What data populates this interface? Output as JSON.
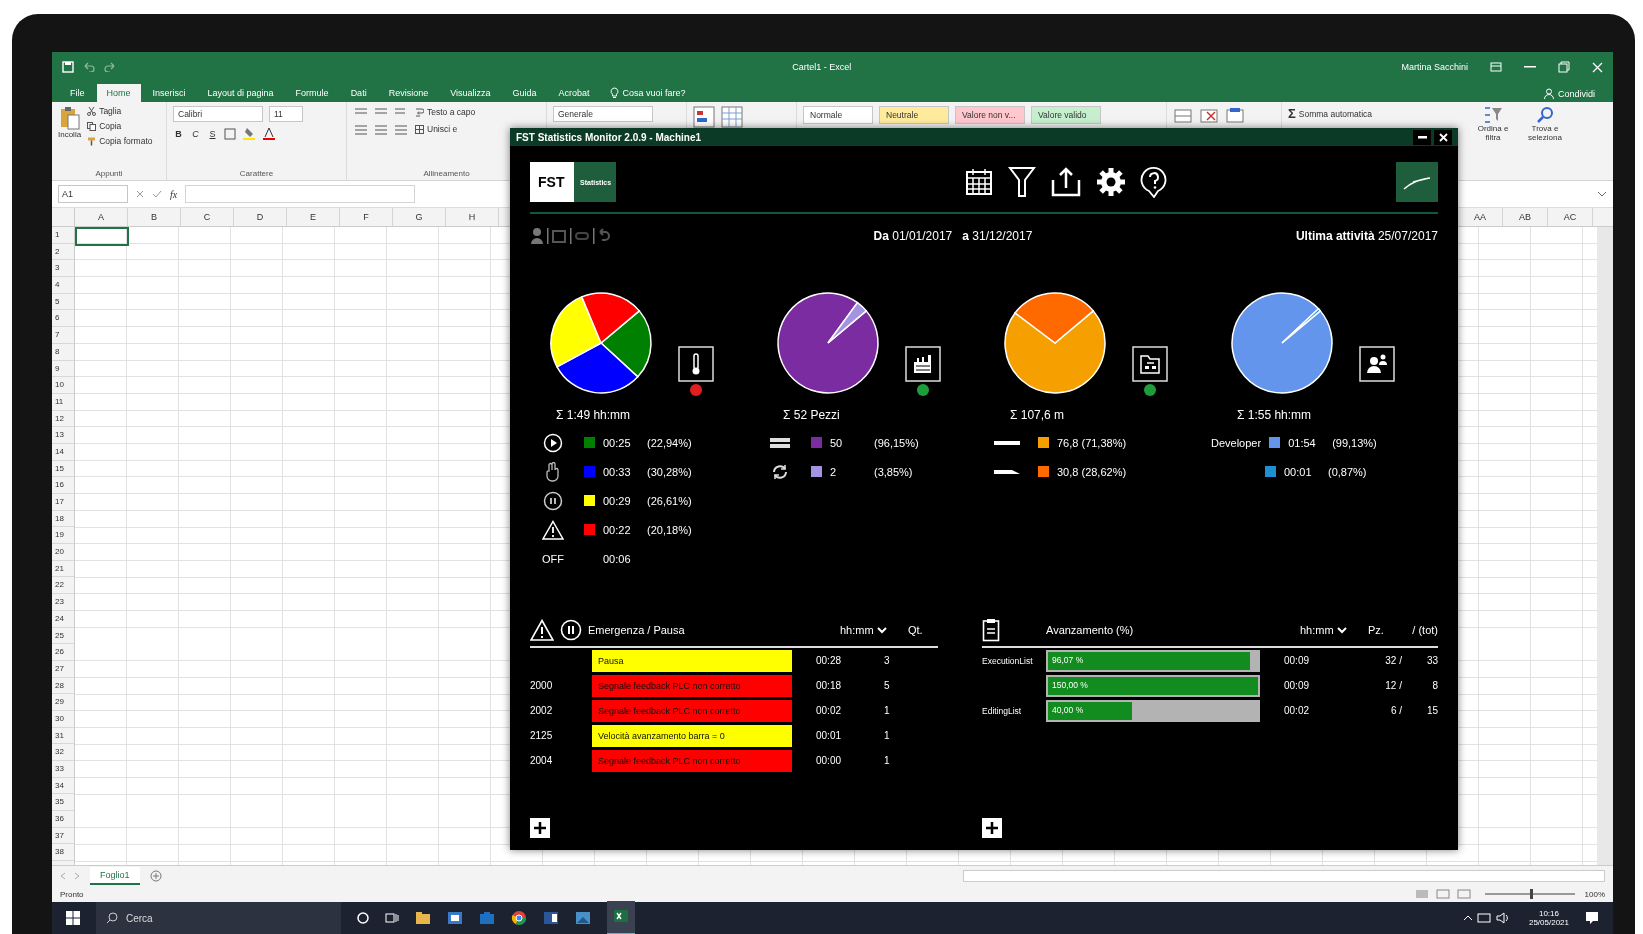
{
  "excel": {
    "title": "Cartel1 - Excel",
    "user": "Martina Sacchini",
    "share": "Condividi",
    "tabs": [
      {
        "label": "File",
        "selected": false
      },
      {
        "label": "Home",
        "selected": true
      },
      {
        "label": "Inserisci",
        "selected": false
      },
      {
        "label": "Layout di pagina",
        "selected": false
      },
      {
        "label": "Formule",
        "selected": false
      },
      {
        "label": "Dati",
        "selected": false
      },
      {
        "label": "Revisione",
        "selected": false
      },
      {
        "label": "Visualizza",
        "selected": false
      },
      {
        "label": "Guida",
        "selected": false
      },
      {
        "label": "Acrobat",
        "selected": false
      }
    ],
    "tell_me": "Cosa vuoi fare?",
    "clipboard": {
      "paste": "Incolla",
      "cut": "Taglia",
      "copy": "Copia",
      "format_painter": "Copia formato",
      "group": "Appunti"
    },
    "font": {
      "family": "Calibri",
      "size": "11",
      "styles": [
        "B",
        "C",
        "S"
      ],
      "group": "Carattere"
    },
    "alignment": {
      "wrap": "Testo a capo",
      "merge": "Unisci e",
      "group": "Allineamento"
    },
    "number_format": "Generale",
    "styles": [
      {
        "label": "Normale",
        "color": "#ffffff"
      },
      {
        "label": "Neutrale",
        "color": "#ffeb9c"
      },
      {
        "label": "Valore non v...",
        "color": "#ffc7ce"
      },
      {
        "label": "Valore valido",
        "color": "#c6efce"
      }
    ],
    "editing": {
      "autosum_symbol": "Σ",
      "autosum": "Somma automatica",
      "sort": "Ordina e filtra",
      "find": "Trova e seleziona"
    },
    "name_box": "A1",
    "function_label": "fx",
    "columns_left": [
      "A",
      "B",
      "C",
      "D",
      "E",
      "F",
      "G",
      "H"
    ],
    "columns_right": [
      "AA",
      "AB",
      "AC"
    ],
    "row_numbers": [
      "1",
      "2",
      "3",
      "4",
      "5",
      "6",
      "7",
      "8",
      "9",
      "10",
      "11",
      "12",
      "13",
      "14",
      "15",
      "16",
      "17",
      "18",
      "19",
      "20",
      "21",
      "22",
      "23",
      "24",
      "25",
      "26",
      "27",
      "28",
      "29",
      "30",
      "31",
      "32",
      "33",
      "34",
      "35",
      "36",
      "37",
      "38"
    ],
    "sheet_tab": "Foglio1",
    "status": "Pronto",
    "zoom_slider": {
      "level": 0.5
    },
    "zoom": "100%"
  },
  "taskbar": {
    "search": "Cerca",
    "time": "10:16",
    "date": "25/05/2021"
  },
  "app": {
    "title": "FST Statistics Monitor 2.0.9 - Machine1",
    "logo": "FST",
    "logo_sub": "Statistics",
    "from": "**Da** 01/01/2017",
    "to": "**a** 31/12/2017",
    "last_activity": "**Ultima attività** 25/07/2017",
    "stats": [
      {
        "status_dot": {
          "color": "#e02020"
        },
        "total": "Σ 1:49 hh:mm",
        "chart_data": {
          "type": "pie",
          "values": [
            22.94,
            30.28,
            26.61,
            20.18
          ]
        },
        "legend": [
          {
            "kind": "play",
            "color": "#008000",
            "value": "00:25",
            "pct": "(22,94%)"
          },
          {
            "kind": "hand",
            "color": "#0000ff",
            "value": "00:33",
            "pct": "(30,28%)"
          },
          {
            "kind": "pause",
            "color": "#ffff00",
            "value": "00:29",
            "pct": "(26,61%)"
          },
          {
            "kind": "warning",
            "color": "#ff0000",
            "value": "00:22",
            "pct": "(20,18%)"
          },
          {
            "kind": "label",
            "label": "OFF",
            "value": "00:06"
          }
        ]
      },
      {
        "status_dot": {
          "color": "#1e9e3a"
        },
        "total": "Σ 52 Pezzi",
        "chart_data": {
          "type": "pie",
          "values": [
            96.15,
            3.85
          ]
        },
        "legend": [
          {
            "kind": "stack",
            "color": "#7b2ca0",
            "value": "50",
            "pct": "(96,15%)"
          },
          {
            "kind": "cycle",
            "color": "#a393e0",
            "value": "2",
            "pct": "(3,85%)"
          }
        ]
      },
      {
        "status_dot": {
          "color": "#1e9e3a"
        },
        "total": "Σ 107,6 m",
        "chart_data": {
          "type": "pie",
          "values": [
            71.38,
            28.62
          ]
        },
        "legend": [
          {
            "kind": "line-long",
            "color": "#f5a000",
            "value": "76,8 (71,38%)"
          },
          {
            "kind": "line-short",
            "color": "#ff6a00",
            "value": "30,8 (28,62%)"
          }
        ]
      },
      {
        "total": "Σ 1:55 hh:mm",
        "chart_data": {
          "type": "pie",
          "values": [
            99.13,
            0.87
          ]
        },
        "legend": [
          {
            "kind": "label",
            "label": "Developer",
            "color": "#6495ed",
            "value": "01:54",
            "pct": "(99,13%)"
          },
          {
            "kind": "label",
            "color": "#1e8fd0",
            "value": "00:01",
            "pct": "(0,87%)"
          }
        ]
      }
    ],
    "alarms": {
      "title": "Emergenza / Pausa",
      "time_col": "hh:mm",
      "qty_col": "Qt.",
      "rows": [
        {
          "code": "",
          "message": "Pausa",
          "color": "#ffff00",
          "time": "00:28",
          "qty": "3"
        },
        {
          "code": "2000",
          "message": "Segnale feedback PLC non corretto",
          "color": "#ff0000",
          "time": "00:18",
          "qty": "5"
        },
        {
          "code": "2002",
          "message": "Segnale feedback PLC non corretto",
          "color": "#ff0000",
          "time": "00:02",
          "qty": "1"
        },
        {
          "code": "2125",
          "message": "Velocità avanzamento barra = 0",
          "color": "#ffff00",
          "time": "00:01",
          "qty": "1"
        },
        {
          "code": "2004",
          "message": "Segnale feedback PLC non corretto",
          "color": "#ff0000",
          "time": "00:00",
          "qty": "1"
        }
      ]
    },
    "progress": {
      "title": "Avanzamento (%)",
      "time_col": "hh:mm",
      "pcs_col": "Pz.",
      "tot_col": "/ (tot)",
      "rows": [
        {
          "label": "ExecutionList",
          "text": "96,07 %",
          "level": 0.96,
          "time": "00:09",
          "pcs": "32 /",
          "tot": "33"
        },
        {
          "label": "",
          "text": "150,00 %",
          "level": 1,
          "time": "00:09",
          "pcs": "12 /",
          "tot": "8"
        },
        {
          "label": "EditingList",
          "text": "40,00 %",
          "level": 0.4,
          "time": "00:02",
          "pcs": "6 /",
          "tot": "15"
        }
      ]
    }
  }
}
